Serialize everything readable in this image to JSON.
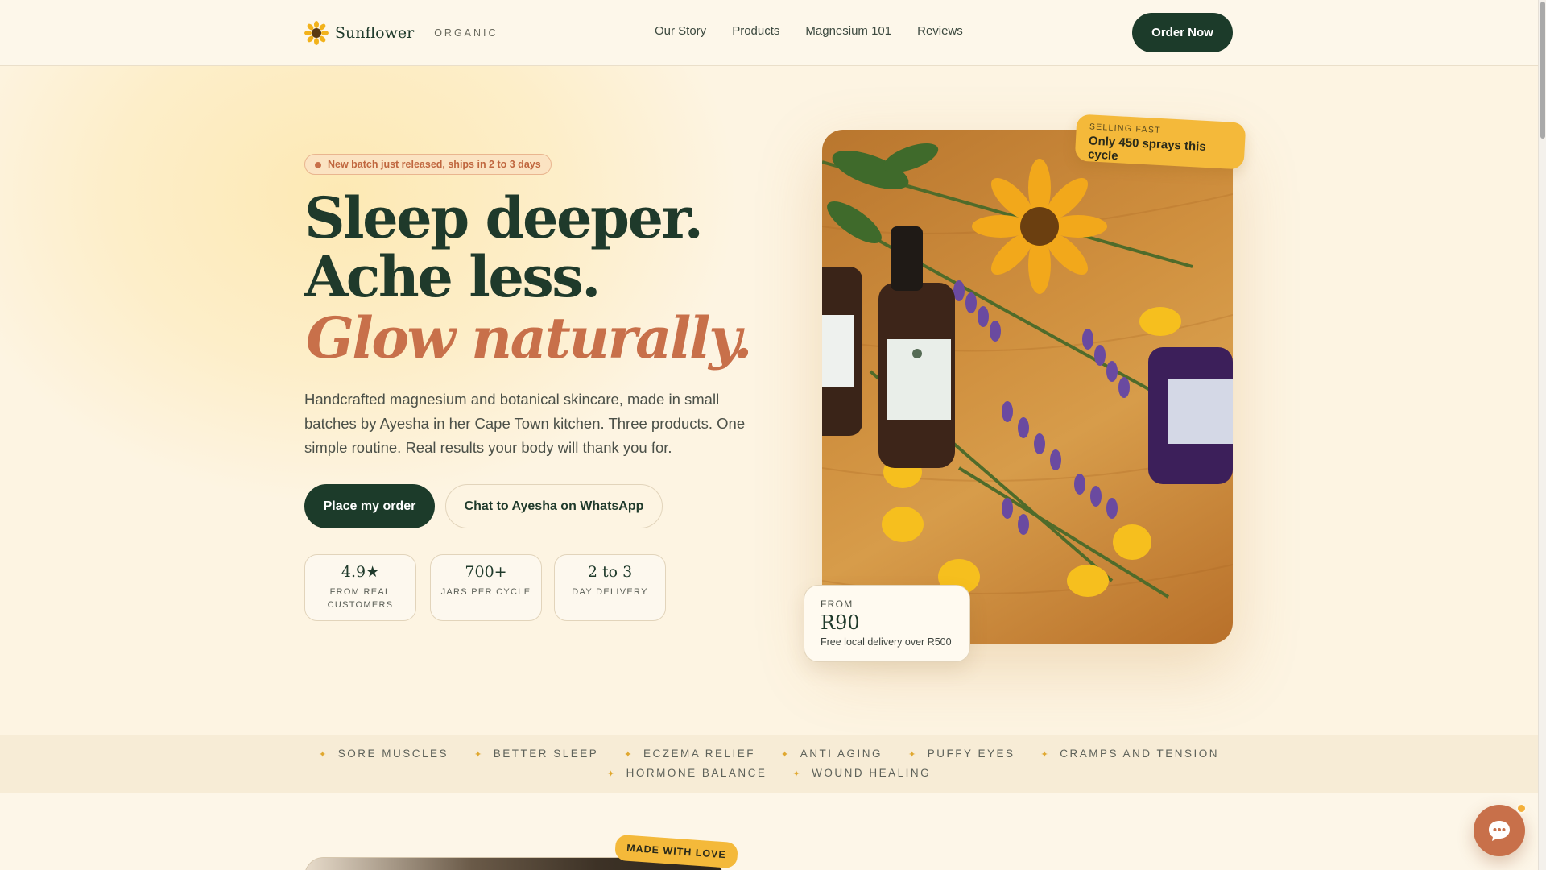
{
  "nav": {
    "brand": "Sunflower",
    "tag": "ORGANIC",
    "links": [
      "Our Story",
      "Products",
      "Magnesium 101",
      "Reviews"
    ],
    "cta": "Order Now"
  },
  "hero": {
    "badge": "New batch just released, ships in 2 to 3 days",
    "headline": "Sleep deeper. Ache less.",
    "headline_accent": "Glow naturally.",
    "lead": "Handcrafted magnesium and botanical skincare, made in small batches by Ayesha in her Cape Town kitchen. Three products. One simple routine. Real results your body will thank you for.",
    "primary_cta": "Place my order",
    "secondary_cta": "Chat to Ayesha on WhatsApp",
    "stats": [
      {
        "value": "4.9★",
        "label": "FROM REAL CUSTOMERS"
      },
      {
        "value": "700+",
        "label": "JARS PER CYCLE"
      },
      {
        "value": "2 to 3",
        "label": "DAY DELIVERY"
      }
    ]
  },
  "product_visual": {
    "selling_label": "SELLING FAST",
    "selling_text": "Only 450 sprays this cycle",
    "price_from": "FROM",
    "price": "R90",
    "price_note": "Free local delivery over R500"
  },
  "benefits": {
    "row1": [
      "SORE MUSCLES",
      "BETTER SLEEP",
      "ECZEMA RELIEF",
      "ANTI AGING",
      "PUFFY EYES",
      "CRAMPS AND TENSION"
    ],
    "row2": [
      "HORMONE BALANCE",
      "WOUND HEALING"
    ]
  },
  "story": {
    "tag": "MADE WITH LOVE"
  },
  "colors": {
    "primary": "#1c3b2a",
    "accent": "#c8704a",
    "highlight": "#f4b93a",
    "background": "#fdf6e8"
  },
  "icons": {
    "logo": "sunflower-icon",
    "chat": "chat-bubble-icon"
  }
}
